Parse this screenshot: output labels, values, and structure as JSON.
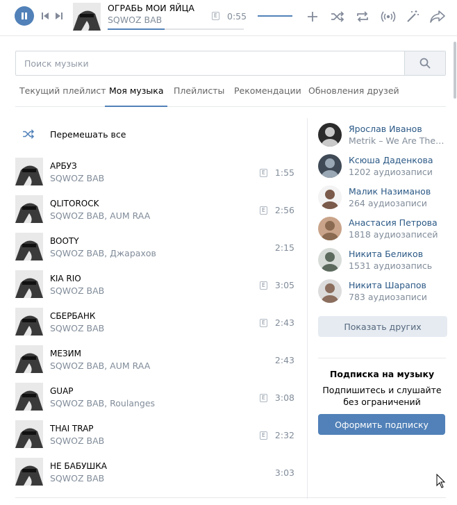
{
  "player": {
    "title": "ОГРАБЬ МОИ ЯЙЦА",
    "artist": "SQWOZ BAB",
    "explicit": "E",
    "time": "0:55",
    "progress_fraction": 0.42,
    "icons": [
      "pause-icon",
      "prev-icon",
      "next-icon",
      "add-icon",
      "shuffle-icon",
      "repeat-icon",
      "broadcast-icon",
      "magic-icon",
      "share-icon"
    ]
  },
  "search": {
    "placeholder": "Поиск музыки"
  },
  "tabs": [
    "Текущий плейлист",
    "Моя музыка",
    "Плейлисты",
    "Рекомендации",
    "Обновления друзей"
  ],
  "active_tab": "Моя музыка",
  "shuffle_all": "Перемешать все",
  "tracks": [
    {
      "title": "АРБУЗ",
      "artist": "SQWOZ BAB",
      "explicit": "E",
      "duration": "1:55"
    },
    {
      "title": "QLITOROCK",
      "artist": "SQWOZ BAB, AUM RAA",
      "explicit": "E",
      "duration": "2:56"
    },
    {
      "title": "BOOTY",
      "artist": "SQWOZ BAB, Джарахов",
      "explicit": "",
      "duration": "2:15"
    },
    {
      "title": "KIA RIO",
      "artist": "SQWOZ BAB",
      "explicit": "E",
      "duration": "3:05"
    },
    {
      "title": "СБЕРБАНК",
      "artist": "SQWOZ BAB",
      "explicit": "E",
      "duration": "2:43"
    },
    {
      "title": "МЕЗИМ",
      "artist": "SQWOZ BAB, AUM RAA",
      "explicit": "",
      "duration": "2:43"
    },
    {
      "title": "GUAP",
      "artist": "SQWOZ BAB, Roulanges",
      "explicit": "E",
      "duration": "3:08"
    },
    {
      "title": "THAI TRAP",
      "artist": "SQWOZ BAB",
      "explicit": "E",
      "duration": "2:32"
    },
    {
      "title": "НЕ БАБУШКА",
      "artist": "SQWOZ BAB",
      "explicit": "",
      "duration": "3:03"
    }
  ],
  "friends": [
    {
      "name": "Ярослав Иванов",
      "sub": "Metrik – We Are The En…"
    },
    {
      "name": "Ксюша Даденкова",
      "sub": "1202 аудиозаписи"
    },
    {
      "name": "Малик Назиманов",
      "sub": "264 аудиозаписи"
    },
    {
      "name": "Анастасия Петрова",
      "sub": "1818 аудиозаписей"
    },
    {
      "name": "Никита Беликов",
      "sub": "1531 аудиозапись"
    },
    {
      "name": "Никита Шарапов",
      "sub": "783 аудиозаписи"
    }
  ],
  "show_more": "Показать других",
  "subscription": {
    "title": "Подписка на музыку",
    "text": "Подпишитесь и слушайте без ограничений",
    "button": "Оформить подписку"
  },
  "colors": {
    "accent": "#5181b8",
    "link": "#2a5885",
    "muted": "#818c99"
  }
}
